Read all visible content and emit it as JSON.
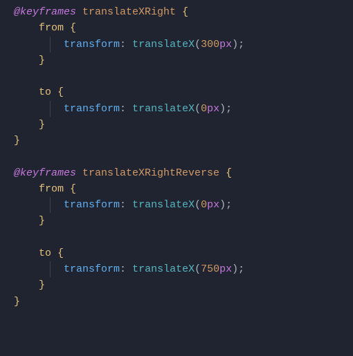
{
  "keyframes": [
    {
      "at": "@keyframes",
      "name": "translateXRight",
      "steps": [
        {
          "selector": "from",
          "prop": "transform",
          "func": "translateX",
          "value": "300",
          "unit": "px"
        },
        {
          "selector": "to",
          "prop": "transform",
          "func": "translateX",
          "value": "0",
          "unit": "px"
        }
      ]
    },
    {
      "at": "@keyframes",
      "name": "translateXRightReverse",
      "steps": [
        {
          "selector": "from",
          "prop": "transform",
          "func": "translateX",
          "value": "0",
          "unit": "px"
        },
        {
          "selector": "to",
          "prop": "transform",
          "func": "translateX",
          "value": "750",
          "unit": "px"
        }
      ]
    }
  ]
}
